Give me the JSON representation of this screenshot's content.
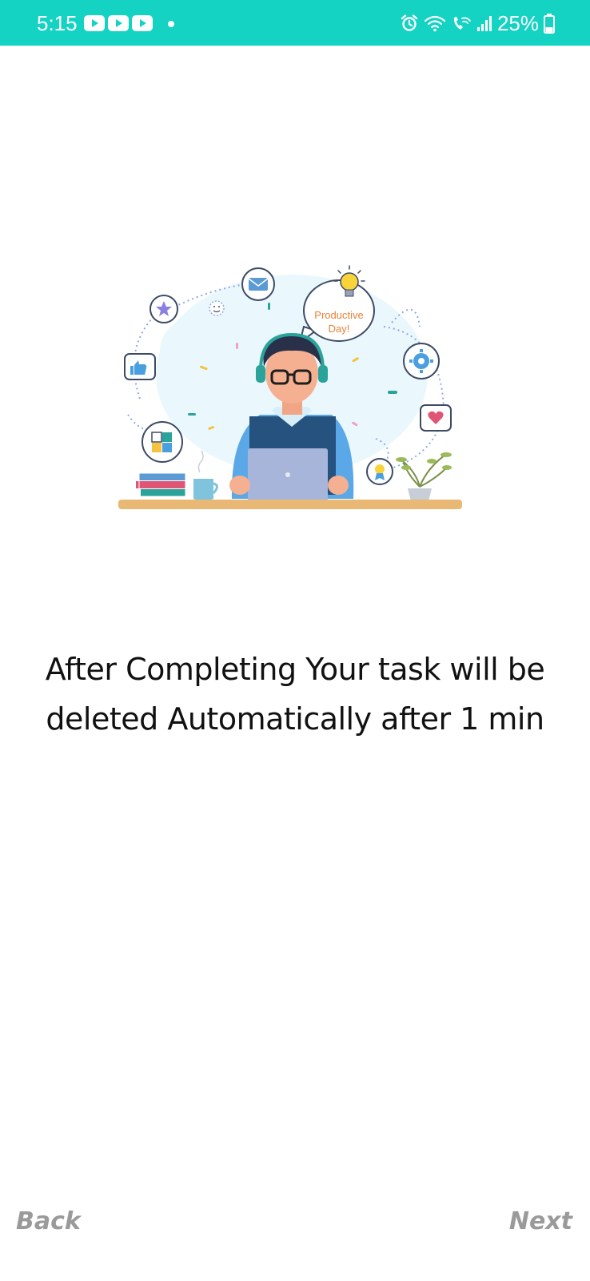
{
  "status_bar": {
    "time": "5:15",
    "battery_percent": "25%",
    "background_color": "#14d3c3",
    "icons": [
      "youtube-icon",
      "youtube-icon",
      "youtube-icon",
      "notification-dot",
      "alarm-icon",
      "wifi-icon",
      "wifi-calling-icon",
      "signal-icon",
      "battery-icon"
    ]
  },
  "illustration": {
    "bubble_text_line1": "Productive",
    "bubble_text_line2": "Day!"
  },
  "onboarding": {
    "message": "After Completing Your task will be deleted Automatically after 1 min"
  },
  "navigation": {
    "back_label": "Back",
    "next_label": "Next"
  }
}
